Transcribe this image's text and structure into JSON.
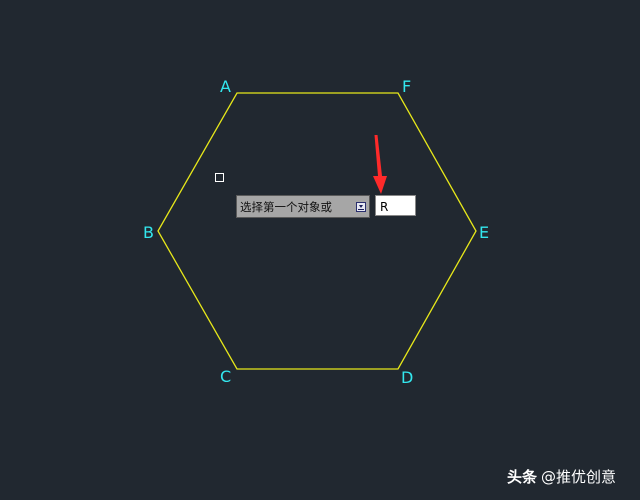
{
  "drawing": {
    "shape": "hexagon",
    "stroke_color": "#e7e81a",
    "label_color": "#33e7ee",
    "background": "#212830",
    "vertices": {
      "a": "A",
      "b": "B",
      "c": "C",
      "d": "D",
      "e": "E",
      "f": "F"
    }
  },
  "command": {
    "prompt": "选择第一个对象或",
    "input_value": "R",
    "options_icon": "dropdown-arrow-icon"
  },
  "annotation": {
    "arrow_color": "#ff2a2a",
    "arrow_icon": "red-arrow-icon"
  },
  "watermark": {
    "brand": "头条",
    "handle": "@推优创意"
  }
}
